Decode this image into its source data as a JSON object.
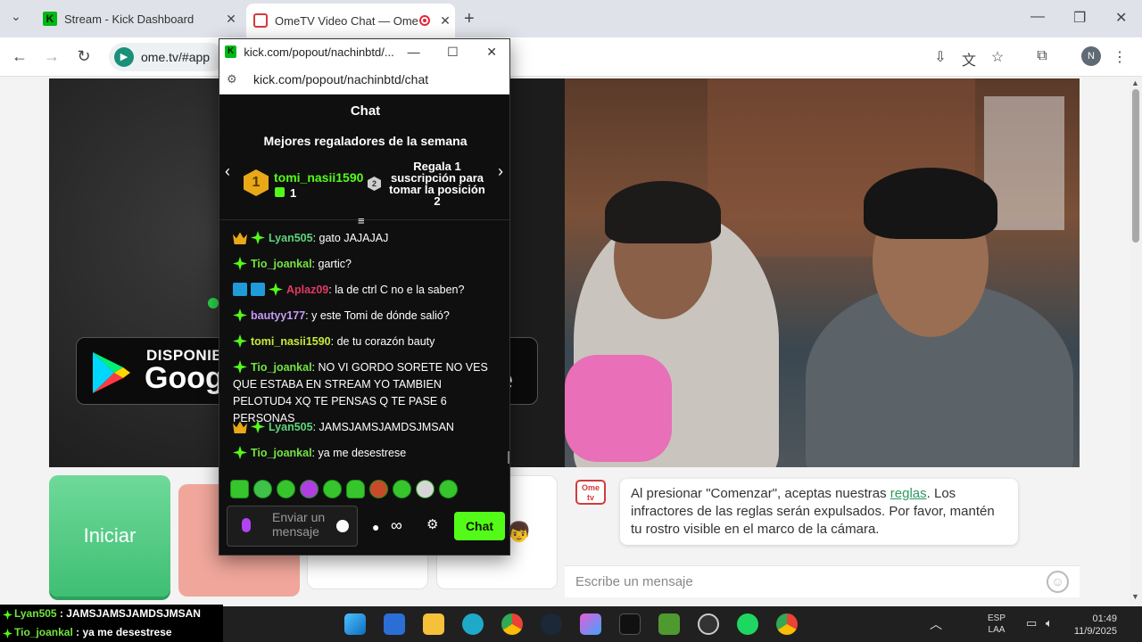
{
  "browser": {
    "tabs": [
      {
        "title": "Stream - Kick Dashboard"
      },
      {
        "title": "OmeTV Video Chat — Ome"
      }
    ],
    "omnibox_url": "ome.tv/#app",
    "profile_initial": "N"
  },
  "popup": {
    "window_title": "kick.com/popout/nachinbtd/...",
    "url": "kick.com/popout/nachinbtd/chat",
    "header": "Chat",
    "gifters_title": "Mejores regaladores de la semana",
    "top_gifter": {
      "rank": "1",
      "name": "tomi_nasii1590",
      "count": "1"
    },
    "second_slot": {
      "rank": "2",
      "text": "Regala 1 suscripción para tomar la posición 2"
    },
    "messages": [
      {
        "user": "Lyan505",
        "text": ": gato JAJAJAJ"
      },
      {
        "user": "Tio_joankal",
        "text": ": gartic?"
      },
      {
        "user": "Aplaz09",
        "text": ": la de ctrl C no e la saben?"
      },
      {
        "user": "bautyy177",
        "text": ": y este Tomi de dónde salió?"
      },
      {
        "user": "tomi_nasii1590",
        "text": ": de tu corazón bauty"
      },
      {
        "user": "Tio_joankal",
        "text": ": NO VI GORDO SORETE NO VES QUE ESTABA EN STREAM YO TAMBIEN PELOTUD4 XQ TE PENSAS Q TE PASE 6 PERSONAS"
      },
      {
        "user": "Lyan505",
        "text": ": JAMSJAMSJAMDSJMSAN"
      },
      {
        "user": "Tio_joankal",
        "text": ": ya me desestrese"
      }
    ],
    "input_placeholder": "Enviar un mensaje",
    "send_label": "Chat",
    "colors": {
      "kick_green": "#53fc18",
      "background": "#0f0f10"
    }
  },
  "ome": {
    "play_badge_small": "DISPONIBLE",
    "play_badge_big": "Googl",
    "play_badge_tail": "e",
    "start_button": "Iniciar",
    "notice_pre": "Al presionar \"Comenzar\", aceptas nuestras ",
    "notice_link": "reglas",
    "notice_post": ". Los infractores de las reglas serán expulsados. Por favor, mantén tu rostro visible en el marco de la cámara.",
    "message_placeholder": "Escribe un mensaje",
    "logo_text": "Ome tv"
  },
  "overlay": [
    {
      "user": "Lyan505",
      "text": " : JAMSJAMSJAMDSJMSAN"
    },
    {
      "user": "Tio_joankal",
      "text": " : ya me desestrese"
    }
  ],
  "taskbar": {
    "lang_top": "ESP",
    "lang_bottom": "LAA",
    "time": "01:49",
    "date": "11/9/2025"
  }
}
